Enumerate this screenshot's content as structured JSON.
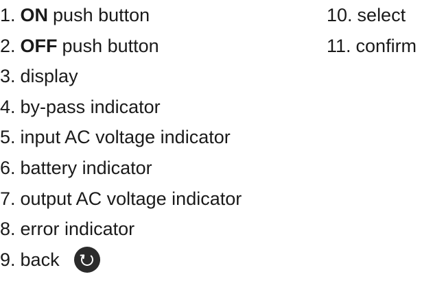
{
  "legend": {
    "left": [
      {
        "num": "1.",
        "strong": "ON",
        "text": "push button"
      },
      {
        "num": "2.",
        "strong": "OFF",
        "text": "push button"
      },
      {
        "num": "3.",
        "strong": "",
        "text": "display"
      },
      {
        "num": "4.",
        "strong": "",
        "text": "by-pass indicator"
      },
      {
        "num": "5.",
        "strong": "",
        "text": "input AC voltage indicator"
      },
      {
        "num": "6.",
        "strong": "",
        "text": "battery indicator"
      },
      {
        "num": "7.",
        "strong": "",
        "text": "output AC voltage indicator"
      },
      {
        "num": "8.",
        "strong": "",
        "text": "error indicator"
      },
      {
        "num": "9.",
        "strong": "",
        "text": "back",
        "icon": "back-rotate-icon"
      }
    ],
    "right": [
      {
        "num": "10.",
        "text": "select"
      },
      {
        "num": "11.",
        "text": "confirm"
      }
    ]
  },
  "colors": {
    "text": "#1a1a1a",
    "icon_bg": "#2b2b2b",
    "icon_fg": "#ffffff"
  }
}
